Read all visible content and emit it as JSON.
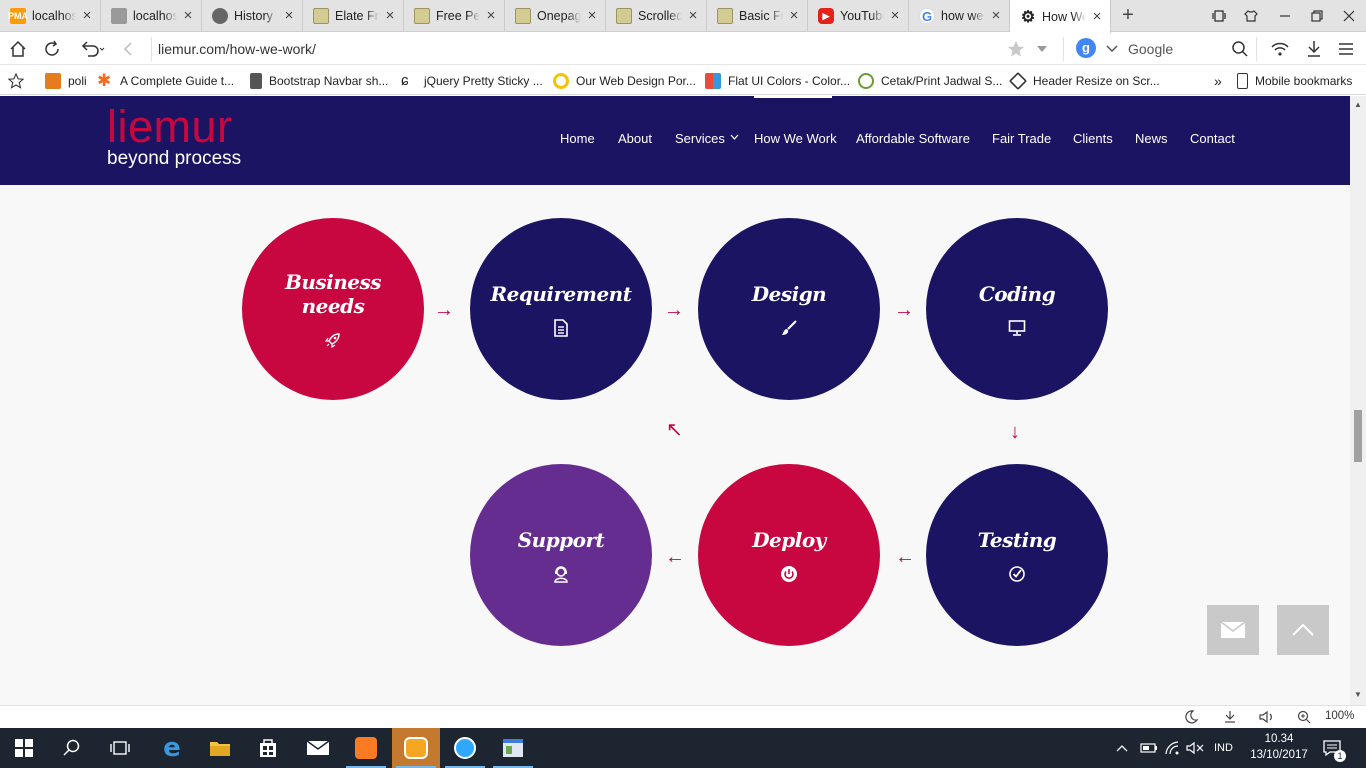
{
  "browser": {
    "tabs": [
      {
        "label": "localhost",
        "icon": "pma-icon",
        "color": "#f89c0e"
      },
      {
        "label": "localhost",
        "icon": "page-icon",
        "color": "#888888"
      },
      {
        "label": "History",
        "icon": "history-icon",
        "color": "#555555"
      },
      {
        "label": "Elate Free",
        "icon": "template-icon",
        "color": "#c9c48a"
      },
      {
        "label": "Free Person",
        "icon": "template-icon",
        "color": "#c9c48a"
      },
      {
        "label": "Onepage",
        "icon": "template-icon",
        "color": "#c9c48a"
      },
      {
        "label": "Scrolled",
        "icon": "template-icon",
        "color": "#c9c48a"
      },
      {
        "label": "Basic Free",
        "icon": "template-icon",
        "color": "#c9c48a"
      },
      {
        "label": "YouTube",
        "icon": "youtube-icon",
        "color": "#e62117"
      },
      {
        "label": "how we",
        "icon": "google-icon",
        "color": "#4285f4"
      },
      {
        "label": "How We Work",
        "icon": "gear-icon",
        "color": "#222222"
      }
    ],
    "active_tab": 10,
    "url": "liemur.com/how-we-work/",
    "search_placeholder": "Google",
    "bookmarks": [
      {
        "label": "poli",
        "color": "#e47d1b"
      },
      {
        "label": "A Complete Guide t...",
        "color": "#f26b21"
      },
      {
        "label": "Bootstrap Navbar sh...",
        "color": "#555555"
      },
      {
        "label": "jQuery Pretty Sticky ...",
        "color": "#222222"
      },
      {
        "label": "Our Web Design Por...",
        "color": "#f5c400"
      },
      {
        "label": "Flat UI Colors - Color...",
        "color": "#3498db"
      },
      {
        "label": "Cetak/Print Jadwal S...",
        "color": "#6a9a33"
      },
      {
        "label": "Header Resize on Scr...",
        "color": "#333333"
      }
    ],
    "bookmarks_overflow": "»",
    "mobile_bookmarks": "Mobile bookmarks",
    "zoom": "100%"
  },
  "site": {
    "logo_main": "liemur",
    "logo_tag": "beyond process",
    "nav": [
      {
        "label": "Home"
      },
      {
        "label": "About"
      },
      {
        "label": "Services"
      },
      {
        "label": "How We Work"
      },
      {
        "label": "Affordable Software"
      },
      {
        "label": "Fair Trade"
      },
      {
        "label": "Clients"
      },
      {
        "label": "News"
      },
      {
        "label": "Contact"
      }
    ],
    "active_nav": "How We Work",
    "colors": {
      "navy": "#1b1462",
      "crimson": "#c8063f",
      "purple": "#662d91"
    }
  },
  "process": [
    {
      "title": "Business needs",
      "icon": "rocket-icon",
      "color": "crimson"
    },
    {
      "title": "Requirement",
      "icon": "document-icon",
      "color": "navy"
    },
    {
      "title": "Design",
      "icon": "brush-icon",
      "color": "navy"
    },
    {
      "title": "Coding",
      "icon": "monitor-icon",
      "color": "navy"
    },
    {
      "title": "Testing",
      "icon": "check-circle-icon",
      "color": "navy"
    },
    {
      "title": "Deploy",
      "icon": "power-icon",
      "color": "crimson"
    },
    {
      "title": "Support",
      "icon": "support-icon",
      "color": "purple"
    }
  ],
  "taskbar": {
    "language": "IND",
    "time": "10.34",
    "date": "13/10/2017",
    "notifications": "1"
  }
}
